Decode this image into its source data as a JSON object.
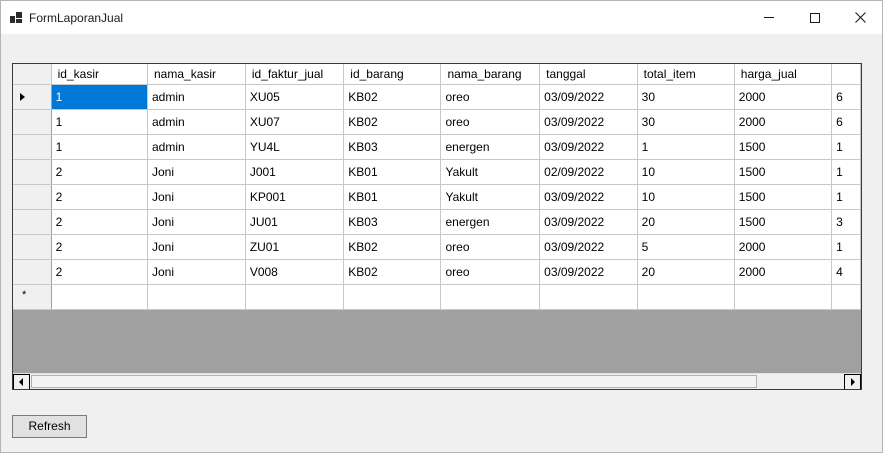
{
  "window": {
    "title": "FormLaporanJual",
    "controls": {
      "minimize": "minimize",
      "maximize": "maximize",
      "close": "close"
    }
  },
  "grid": {
    "columns": [
      "id_kasir",
      "nama_kasir",
      "id_faktur_jual",
      "id_barang",
      "nama_barang",
      "tanggal",
      "total_item",
      "harga_jual",
      ""
    ],
    "rows": [
      [
        "1",
        "admin",
        "XU05",
        "KB02",
        "oreo",
        "03/09/2022",
        "30",
        "2000",
        "6"
      ],
      [
        "1",
        "admin",
        "XU07",
        "KB02",
        "oreo",
        "03/09/2022",
        "30",
        "2000",
        "6"
      ],
      [
        "1",
        "admin",
        "YU4L",
        "KB03",
        "energen",
        "03/09/2022",
        "1",
        "1500",
        "1"
      ],
      [
        "2",
        "Joni",
        "J001",
        "KB01",
        "Yakult",
        "02/09/2022",
        "10",
        "1500",
        "1"
      ],
      [
        "2",
        "Joni",
        "KP001",
        "KB01",
        "Yakult",
        "03/09/2022",
        "10",
        "1500",
        "1"
      ],
      [
        "2",
        "Joni",
        "JU01",
        "KB03",
        "energen",
        "03/09/2022",
        "20",
        "1500",
        "3"
      ],
      [
        "2",
        "Joni",
        "ZU01",
        "KB02",
        "oreo",
        "03/09/2022",
        "5",
        "2000",
        "1"
      ],
      [
        "2",
        "Joni",
        "V008",
        "KB02",
        "oreo",
        "03/09/2022",
        "20",
        "2000",
        "4"
      ]
    ],
    "new_row_marker": "*",
    "selected_cell": {
      "row": 0,
      "col": 0
    }
  },
  "buttons": {
    "refresh": "Refresh"
  },
  "colors": {
    "selection": "#0078d7",
    "grid_background": "#a0a0a0",
    "window_background": "#f0f0f0"
  }
}
